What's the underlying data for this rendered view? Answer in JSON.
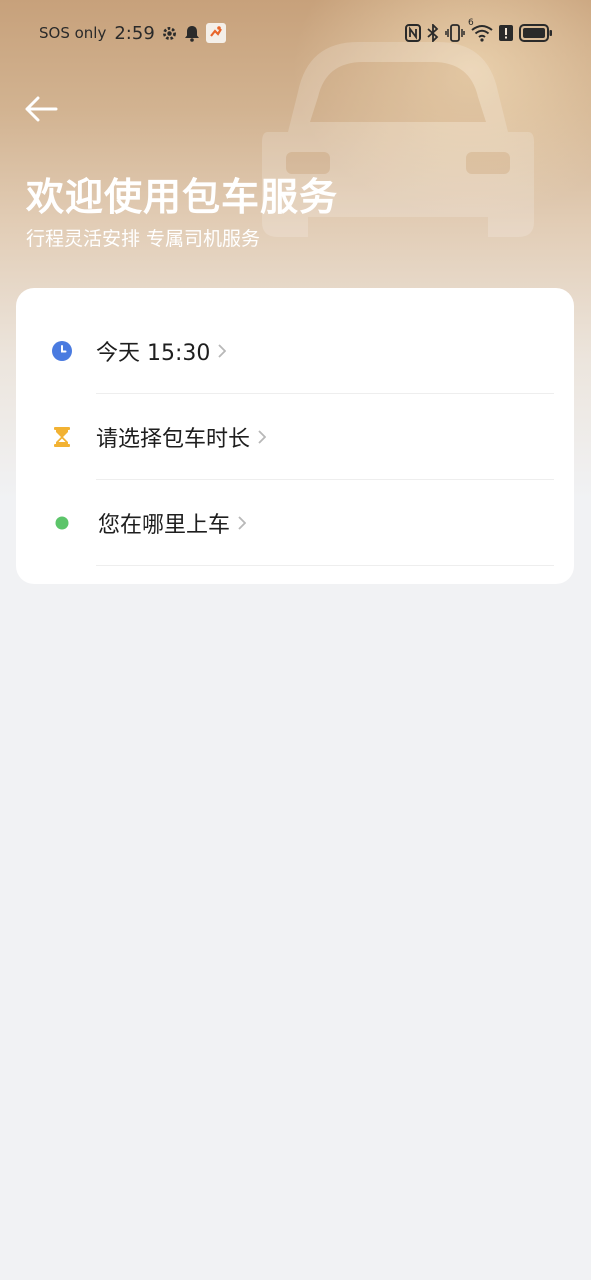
{
  "status_bar": {
    "carrier": "SOS only",
    "time": "2:59",
    "left_icons": [
      "gear-icon",
      "bell-icon",
      "app-notification-icon"
    ],
    "right_icons": [
      "nfc-icon",
      "bluetooth-icon",
      "vibrate-icon",
      "wifi-icon",
      "alert-icon",
      "battery-icon"
    ],
    "wifi_badge": "6"
  },
  "header": {
    "back_icon": "arrow-left-icon",
    "title": "欢迎使用包车服务",
    "subtitle": "行程灵活安排 专属司机服务"
  },
  "form": {
    "rows": [
      {
        "label": "今天 15:30",
        "icon": "clock-icon",
        "icon_color": "#4a7be0"
      },
      {
        "label": "请选择包车时长",
        "icon": "hourglass-icon",
        "icon_color": "#f2b233"
      },
      {
        "label": "您在哪里上车",
        "icon": "dot-icon",
        "icon_color": "#5cc56a"
      }
    ]
  }
}
